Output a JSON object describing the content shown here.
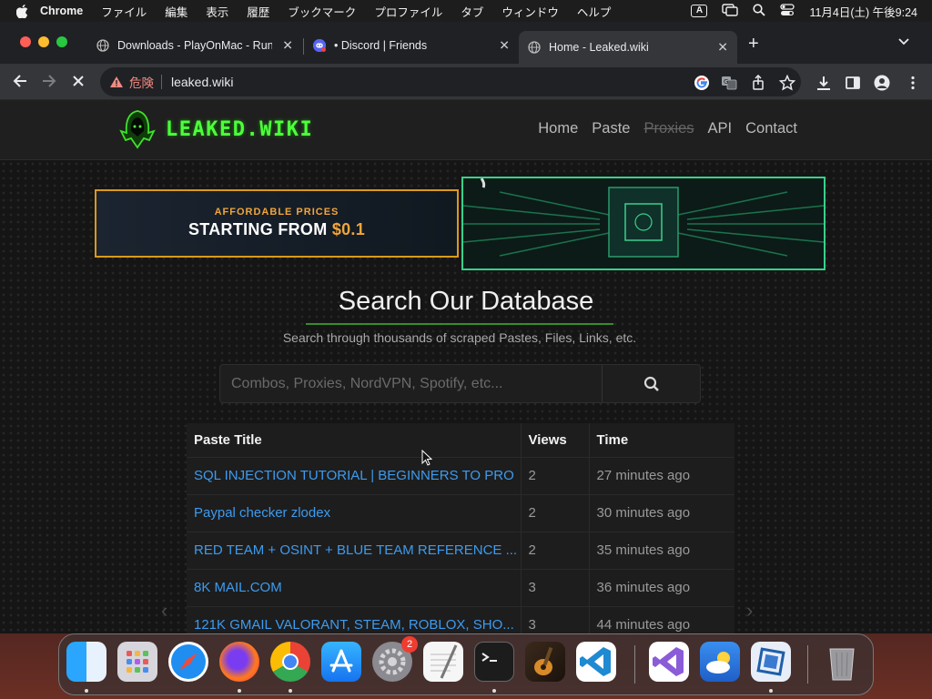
{
  "menubar": {
    "app": "Chrome",
    "items": [
      "ファイル",
      "編集",
      "表示",
      "履歴",
      "ブックマーク",
      "プロファイル",
      "タブ",
      "ウィンドウ",
      "ヘルプ"
    ],
    "input_indicator": "A",
    "datetime": "11月4日(土) 午後9:24"
  },
  "browser": {
    "tabs": [
      {
        "title": "Downloads - PlayOnMac - Run",
        "favicon": "globe-icon"
      },
      {
        "title": "• Discord | Friends",
        "favicon": "discord-icon"
      },
      {
        "title": "Home - Leaked.wiki",
        "favicon": "globe-icon",
        "active": true
      }
    ],
    "security_label": "危険",
    "url": "leaked.wiki"
  },
  "site": {
    "logo_text": "LEAKED.WIKI",
    "nav": [
      {
        "label": "Home"
      },
      {
        "label": "Paste"
      },
      {
        "label": "Proxies",
        "struck": true
      },
      {
        "label": "API"
      },
      {
        "label": "Contact"
      }
    ],
    "banner_left": {
      "small": "AFFORDABLE PRICES",
      "big_prefix": "STARTING FROM ",
      "big_price": "$0.1"
    },
    "search": {
      "title": "Search Our Database",
      "subtitle": "Search through thousands of scraped Pastes, Files, Links, etc.",
      "placeholder": "Combos, Proxies, NordVPN, Spotify, etc..."
    },
    "table": {
      "headers": [
        "Paste Title",
        "Views",
        "Time"
      ],
      "rows": [
        {
          "title": "SQL INJECTION TUTORIAL | BEGINNERS TO PRO",
          "views": "2",
          "time": "27 minutes ago"
        },
        {
          "title": "Paypal checker zlodex",
          "views": "2",
          "time": "30 minutes ago"
        },
        {
          "title": "RED TEAM + OSINT + BLUE TEAM REFERENCE ...",
          "views": "2",
          "time": "35 minutes ago"
        },
        {
          "title": "8K MAIL.COM",
          "views": "3",
          "time": "36 minutes ago"
        },
        {
          "title": "121K GMAIL VALORANT, STEAM, ROBLOX, SHO...",
          "views": "3",
          "time": "44 minutes ago"
        }
      ]
    }
  },
  "dock": {
    "items": [
      "finder",
      "launchpad",
      "safari",
      "firefox",
      "chrome",
      "app-store",
      "system-settings",
      "textedit",
      "terminal",
      "garageband",
      "vscode",
      "visual-studio",
      "weather",
      "virtualbox",
      "trash"
    ],
    "settings_badge": "2"
  },
  "colors": {
    "accent_green": "#4dff3b",
    "link_blue": "#3d9bf0",
    "price_orange": "#f2a53a"
  }
}
